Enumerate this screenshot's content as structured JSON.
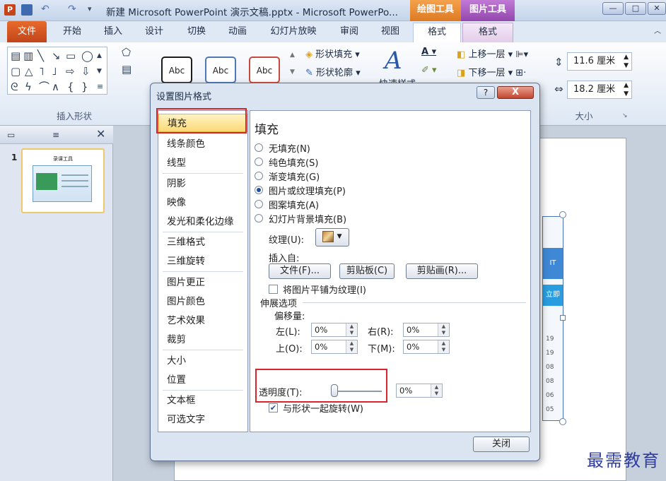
{
  "titlebar": {
    "title": "新建 Microsoft PowerPoint 演示文稿.pptx - Microsoft PowerPo...",
    "ctx_drawing": "绘图工具",
    "ctx_picture": "图片工具",
    "app_icon": "P"
  },
  "tabs": {
    "file": "文件",
    "home": "开始",
    "insert": "插入",
    "design": "设计",
    "transitions": "切换",
    "animations": "动画",
    "slideshow": "幻灯片放映",
    "review": "审阅",
    "view": "视图",
    "format1": "格式",
    "format2": "格式"
  },
  "ribbon": {
    "insert_shapes_label": "插入形状",
    "style_sample": "Abc",
    "shape_fill": "形状填充",
    "shape_outline": "形状轮廓",
    "quick_styles": "快速样式",
    "bring_forward": "上移一层",
    "send_backward": "下移一层",
    "height_value": "11.6 厘米",
    "width_value": "18.2 厘米",
    "size_label": "大小"
  },
  "slides": {
    "number": "1",
    "thumb_title": "录课工具"
  },
  "dialog": {
    "title": "设置图片格式",
    "help": "?",
    "close_x": "X",
    "nav": [
      "填充",
      "线条颜色",
      "线型",
      "阴影",
      "映像",
      "发光和柔化边缘",
      "三维格式",
      "三维旋转",
      "图片更正",
      "图片颜色",
      "艺术效果",
      "裁剪",
      "大小",
      "位置",
      "文本框",
      "可选文字"
    ],
    "heading": "填充",
    "radios": [
      "无填充(N)",
      "纯色填充(S)",
      "渐变填充(G)",
      "图片或纹理填充(P)",
      "图案填充(A)",
      "幻灯片背景填充(B)"
    ],
    "texture_label": "纹理(U):",
    "insert_from": "插入自:",
    "btn_file": "文件(F)...",
    "btn_clipboard": "剪贴板(C)",
    "btn_clipart": "剪贴画(R)...",
    "tile_checkbox": "将图片平铺为纹理(I)",
    "stretch_options": "伸展选项",
    "offsets": "偏移量:",
    "left_lbl": "左(L):",
    "left_val": "0%",
    "right_lbl": "右(R):",
    "right_val": "0%",
    "top_lbl": "上(O):",
    "top_val": "0%",
    "bottom_lbl": "下(M):",
    "bottom_val": "0%",
    "transparency_lbl": "透明度(T):",
    "transparency_val": "0%",
    "rotate_checkbox": "与形状一起旋转(W)",
    "close_button": "关闭"
  },
  "slide_side_texts": [
    "IT",
    "立即",
    "19",
    "19",
    "08",
    "08",
    "06",
    "05"
  ],
  "watermark": "最需教育",
  "colors": {
    "file_tab": "#d4561f",
    "drawing_tools": "#e8872b",
    "picture_tools": "#9a4fb3",
    "highlight": "#d8252b",
    "watermark": "#2f3da0"
  }
}
